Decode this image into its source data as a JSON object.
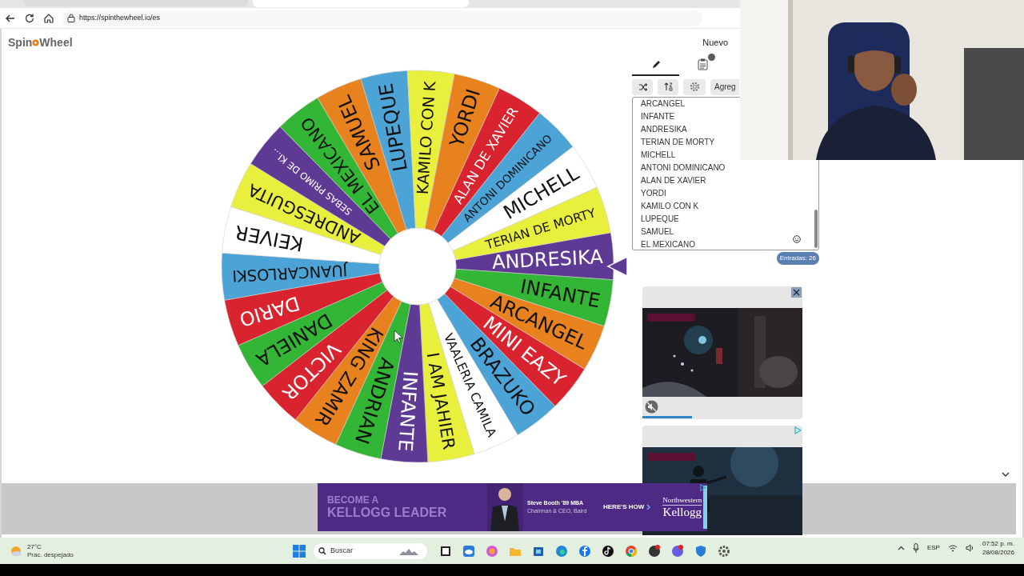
{
  "browser": {
    "url": "https://spinthewheel.io/es"
  },
  "logo": {
    "left": "Spin",
    "right": "Wheel"
  },
  "wheel": {
    "segments": [
      {
        "label": "ANDRESIKA",
        "color": "#5e3a95"
      },
      {
        "label": "INFANTE",
        "color": "#33b535"
      },
      {
        "label": "ARCANGEL",
        "color": "#e8821e"
      },
      {
        "label": "MINI EAZY",
        "color": "#d9232e"
      },
      {
        "label": "BRAZUKO",
        "color": "#4ca3d6"
      },
      {
        "label": "VAALERIA CAMILA",
        "color": "#ffffff"
      },
      {
        "label": "I AM JAHIER",
        "color": "#e8ef3c"
      },
      {
        "label": "INFANTE",
        "color": "#5e3a95"
      },
      {
        "label": "ANDRIAN",
        "color": "#33b535"
      },
      {
        "label": "KING ZAMIR",
        "color": "#e8821e"
      },
      {
        "label": "VICTOR",
        "color": "#d9232e"
      },
      {
        "label": "DANIELA",
        "color": "#33b535"
      },
      {
        "label": "DARIO",
        "color": "#d9232e"
      },
      {
        "label": "JUANCARLOSKI",
        "color": "#4ca3d6"
      },
      {
        "label": "KEIVER",
        "color": "#ffffff"
      },
      {
        "label": "ANDRESGUITA",
        "color": "#e8ef3c"
      },
      {
        "label": "SEBAS PRIMO DE KI...",
        "color": "#5e3a95"
      },
      {
        "label": "EL MEXICANO",
        "color": "#33b535"
      },
      {
        "label": "SAMUEL",
        "color": "#e8821e"
      },
      {
        "label": "LUPEQUE",
        "color": "#4ca3d6"
      },
      {
        "label": "KAMILO CON K",
        "color": "#e8ef3c"
      },
      {
        "label": "YORDI",
        "color": "#e8821e"
      },
      {
        "label": "ALAN DE XAVIER",
        "color": "#d9232e"
      },
      {
        "label": "ANTONI DOMINICANO",
        "color": "#4ca3d6"
      },
      {
        "label": "MICHELL",
        "color": "#ffffff"
      },
      {
        "label": "TERIAN DE MORTY",
        "color": "#e8ef3c"
      }
    ]
  },
  "panel": {
    "new_button": "Nuevo",
    "tabs": [
      {
        "kind": "edit",
        "selected": true
      },
      {
        "kind": "results",
        "selected": false
      }
    ],
    "add_button": "Agreg",
    "entries": [
      "ARCANGEL",
      "INFANTE",
      "ANDRESIKA",
      "TERIAN DE MORTY",
      "MICHELL",
      "ANTONI DOMINICANO",
      "ALAN DE XAVIER",
      "YORDI",
      "KAMILO CON K",
      "LUPEQUE",
      "SAMUEL",
      "EL MEXICANO"
    ],
    "count": "Entradas: 26"
  },
  "video_ad": {
    "progress": {
      "level": 0.31
    }
  },
  "banner": {
    "line_1": "BECOME A",
    "line_2": "KELLOGG LEADER",
    "person_name": "Steve Booth '89 MBA",
    "person_title": "Chairman & CEO, Baird",
    "cta": "HERE'S HOW",
    "brand_top": "Northwestern",
    "brand": "Kellogg"
  },
  "taskbar": {
    "temperature": "27°C",
    "weather": "Prac. despejado",
    "search_placeholder": "Buscar",
    "language": "ESP",
    "time": "07:52 p. m.",
    "date": "28/08/2026"
  }
}
